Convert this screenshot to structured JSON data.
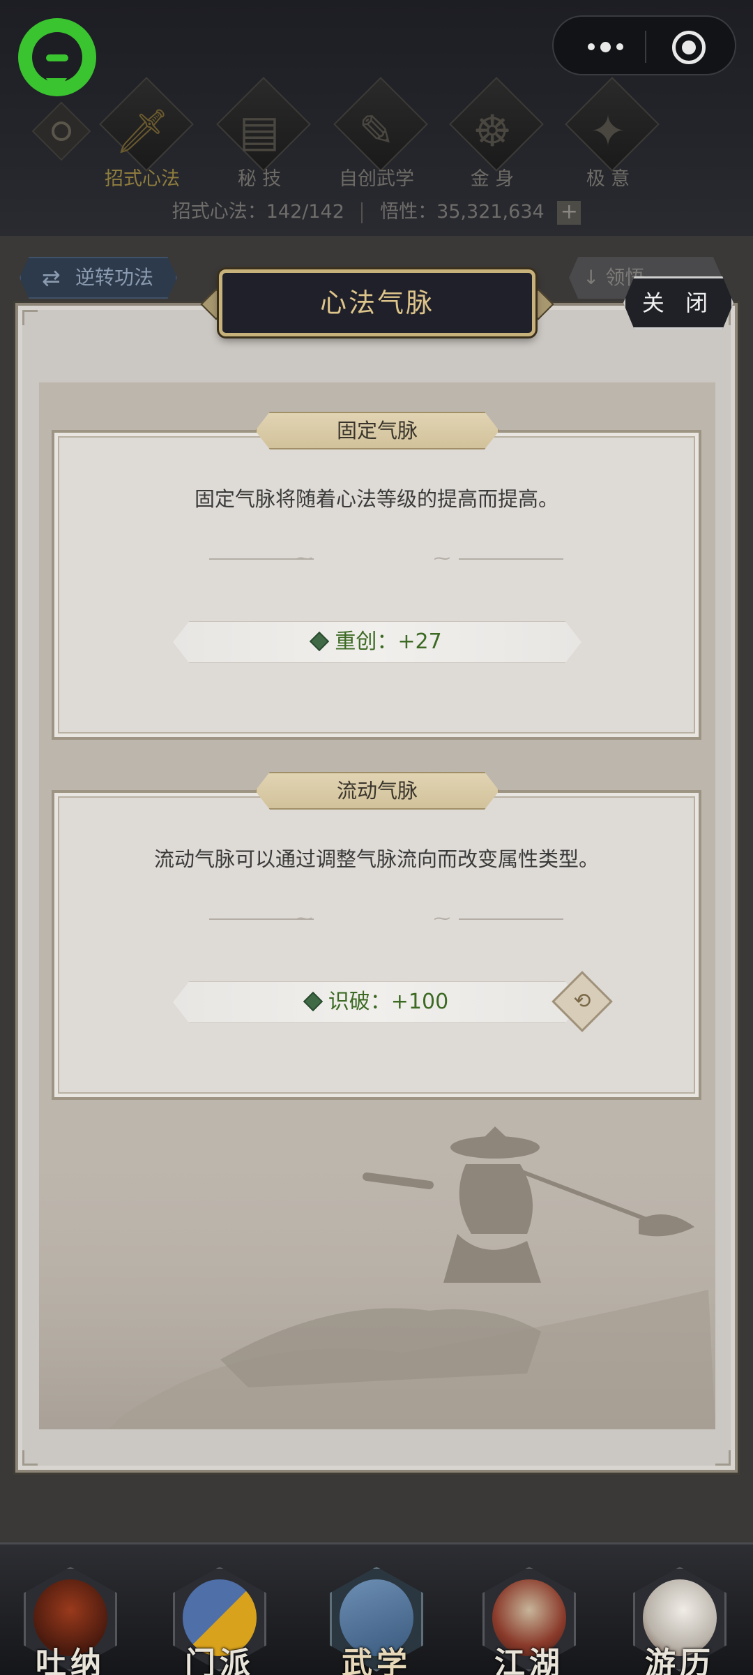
{
  "header": {
    "categories": [
      {
        "label": "招式心法",
        "icon": "sword-icon",
        "active": true
      },
      {
        "label": "秘 技",
        "icon": "book-icon",
        "active": false
      },
      {
        "label": "自创武学",
        "icon": "scroll-icon",
        "active": false
      },
      {
        "label": "金 身",
        "icon": "meditation-icon",
        "active": false
      },
      {
        "label": "极 意",
        "icon": "martial-stance-icon",
        "active": false
      }
    ],
    "stats": {
      "moves_label": "招式心法：",
      "moves_value": "142/142",
      "comprehension_label": "悟性：",
      "comprehension_value": "35,321,634",
      "plus": "+"
    }
  },
  "background_buttons": {
    "reverse_label": "逆转功法",
    "reverse_icon": "⇄",
    "right_label": "领悟"
  },
  "modal": {
    "title": "心法气脉",
    "close_label": "关 闭",
    "fixed": {
      "heading": "固定气脉",
      "description": "固定气脉将随着心法等级的提高而提高。",
      "stat_label": "重创：",
      "stat_value": "+27"
    },
    "flow": {
      "heading": "流动气脉",
      "description": "流动气脉可以通过调整气脉流向而改变属性类型。",
      "stat_label": "识破：",
      "stat_value": "+100",
      "swap_icon": "swap-icon"
    }
  },
  "bottom_nav": [
    {
      "label": "吐纳",
      "icon": "monk-icon",
      "active": false
    },
    {
      "label": "门派",
      "icon": "banner-icon",
      "active": false
    },
    {
      "label": "武学",
      "icon": "books-icon",
      "active": true
    },
    {
      "label": "江湖",
      "icon": "straw-hat-icon",
      "active": false
    },
    {
      "label": "游历",
      "icon": "horse-icon",
      "active": false
    }
  ],
  "colors": {
    "accent_gold": "#ddc48a",
    "stat_green": "#3c6a23",
    "wechat_green": "#3ac42f"
  }
}
